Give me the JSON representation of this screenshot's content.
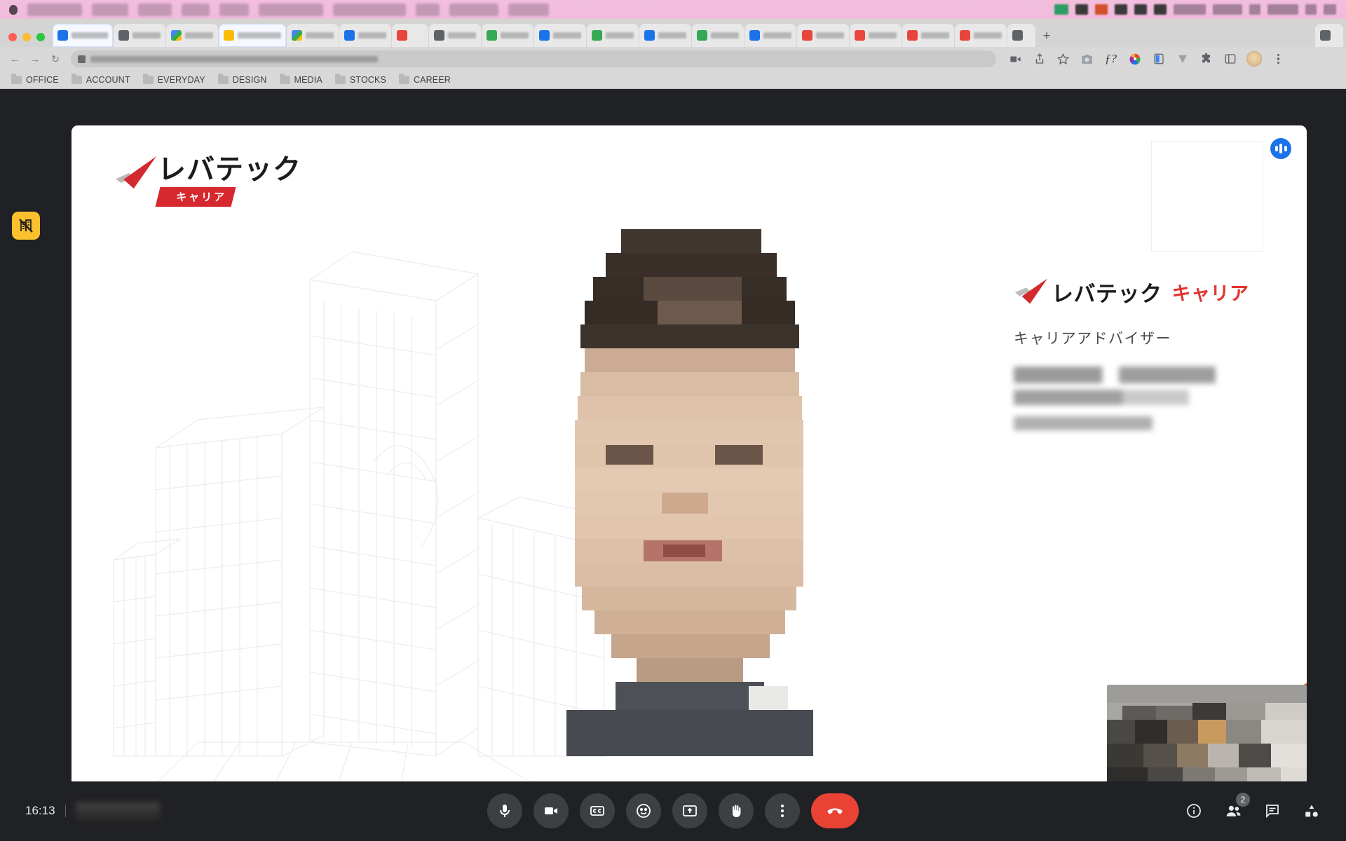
{
  "os_menubar": {
    "apple_icon": "apple-logo-icon",
    "items": [
      "",
      "",
      "",
      "",
      "",
      "",
      "",
      ""
    ],
    "status_icons": [
      "dropbox-icon",
      "shield-icon",
      "app-icon",
      "display-icon",
      "cloud-icon",
      "battery-icon",
      "wifi-icon",
      "clock-icon",
      "search-icon",
      "control-center-icon"
    ]
  },
  "browser": {
    "window_controls": [
      "close",
      "minimize",
      "maximize"
    ],
    "tabs": [
      {
        "favicon": "blue",
        "title": "",
        "active": false
      },
      {
        "favicon": "grey",
        "title": "",
        "active": false
      },
      {
        "favicon": "multi",
        "title": "",
        "active": false
      },
      {
        "favicon": "yellow",
        "title": "",
        "active": true
      },
      {
        "favicon": "multi",
        "title": "",
        "active": false
      },
      {
        "favicon": "blue",
        "title": "",
        "active": false
      },
      {
        "favicon": "red",
        "title": "",
        "active": false
      },
      {
        "favicon": "grey",
        "title": "",
        "active": false
      },
      {
        "favicon": "green",
        "title": "",
        "active": false
      },
      {
        "favicon": "blue",
        "title": "",
        "active": false
      },
      {
        "favicon": "green",
        "title": "",
        "active": false
      },
      {
        "favicon": "blue",
        "title": "",
        "active": false
      },
      {
        "favicon": "green",
        "title": "",
        "active": false
      },
      {
        "favicon": "blue",
        "title": "",
        "active": false
      },
      {
        "favicon": "red",
        "title": "",
        "active": false
      },
      {
        "favicon": "red",
        "title": "",
        "active": false
      },
      {
        "favicon": "red",
        "title": "",
        "active": false
      },
      {
        "favicon": "red",
        "title": "",
        "active": false
      },
      {
        "favicon": "grey",
        "title": "",
        "active": false
      }
    ],
    "new_tab_label": "+",
    "back_label": "←",
    "forward_label": "→",
    "reload_label": "↻",
    "omnibox": {
      "value": "",
      "placeholder": "",
      "lock_icon": "site-info-icon"
    },
    "toolbar_icons": [
      "video-record-icon",
      "share-icon",
      "bookmark-star-icon",
      "screenshot-camera-icon",
      "font-tool-icon",
      "color-wheel-icon",
      "split-view-icon",
      "download-icon",
      "extensions-puzzle-icon",
      "side-panel-icon",
      "profile-avatar-icon",
      "browser-menu-icon"
    ],
    "bookmarks": [
      {
        "label": "OFFICE",
        "icon": "folder-icon"
      },
      {
        "label": "ACCOUNT",
        "icon": "folder-icon"
      },
      {
        "label": "EVERYDAY",
        "icon": "folder-icon"
      },
      {
        "label": "DESIGN",
        "icon": "folder-icon"
      },
      {
        "label": "MEDIA",
        "icon": "folder-icon"
      },
      {
        "label": "STOCKS",
        "icon": "folder-icon"
      },
      {
        "label": "CAREER",
        "icon": "folder-icon"
      }
    ]
  },
  "extension_badge": {
    "icon": "blocked-calculator-icon",
    "color": "#fbc02d"
  },
  "meet": {
    "stage": {
      "brand": {
        "kana": "レバテック",
        "ribbon": "キャリア",
        "logo_icon": "levtech-check-logo-icon",
        "red": "#d7282f"
      },
      "panel": {
        "logo_icon": "levtech-check-logo-icon",
        "kana": "レバテック",
        "kana_accent": "キャリア",
        "role": "キャリアアドバイザー",
        "name_redacted": "",
        "subtitle_redacted": ""
      },
      "audio_indicator_icon": "speaking-audio-icon",
      "self_view_label": ""
    },
    "bottom_bar": {
      "time": "16:13",
      "meeting_code": "",
      "controls": [
        {
          "name": "microphone-button",
          "icon": "microphone-icon",
          "label": "Turn off microphone"
        },
        {
          "name": "camera-button",
          "icon": "video-camera-icon",
          "label": "Turn off camera"
        },
        {
          "name": "captions-button",
          "icon": "closed-captions-icon",
          "label": "Turn on captions"
        },
        {
          "name": "reactions-button",
          "icon": "emoji-smiley-icon",
          "label": "Send a reaction"
        },
        {
          "name": "present-button",
          "icon": "present-screen-icon",
          "label": "Present now"
        },
        {
          "name": "raise-hand-button",
          "icon": "raise-hand-icon",
          "label": "Raise hand"
        },
        {
          "name": "more-options-button",
          "icon": "more-vertical-icon",
          "label": "More options"
        },
        {
          "name": "leave-call-button",
          "icon": "end-call-icon",
          "label": "Leave call"
        }
      ],
      "right_icons": [
        {
          "name": "meeting-details-button",
          "icon": "info-circle-icon",
          "label": "Meeting details",
          "badge": ""
        },
        {
          "name": "participants-button",
          "icon": "people-icon",
          "label": "Show everyone",
          "badge": "2"
        },
        {
          "name": "chat-button",
          "icon": "chat-bubble-icon",
          "label": "Chat with everyone",
          "badge": ""
        },
        {
          "name": "activities-button",
          "icon": "activities-shapes-icon",
          "label": "Activities",
          "badge": ""
        }
      ]
    }
  }
}
